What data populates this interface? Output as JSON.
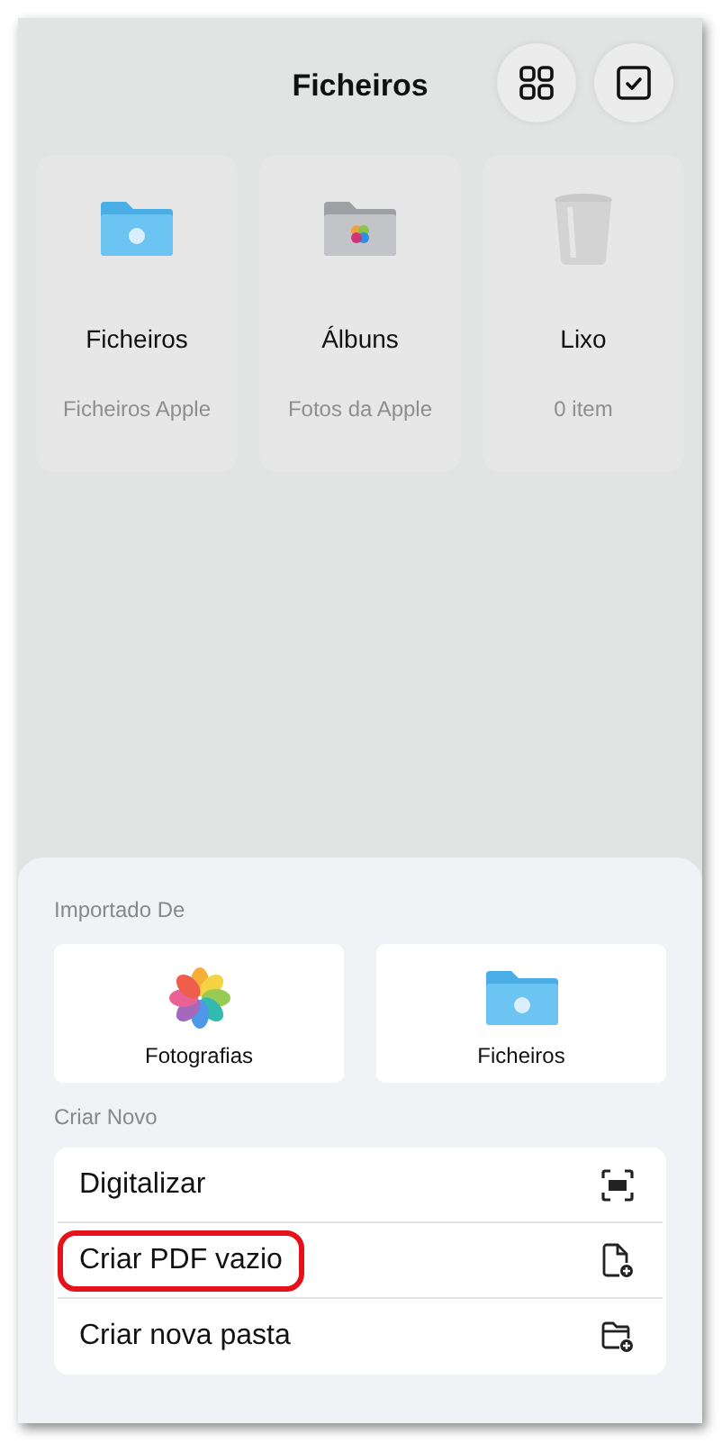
{
  "header": {
    "title": "Ficheiros"
  },
  "header_buttons": [
    {
      "kind": "grid"
    },
    {
      "kind": "select"
    }
  ],
  "locations": [
    {
      "kind": "apple-folder",
      "name": "Ficheiros",
      "subtitle": "Ficheiros Apple"
    },
    {
      "kind": "photos-folder",
      "name": "Álbuns",
      "subtitle": "Fotos da Apple"
    },
    {
      "kind": "trash",
      "name": "Lixo",
      "subtitle": "0 item"
    }
  ],
  "sheet": {
    "imported_title": "Importado De",
    "sources": [
      {
        "kind": "photos",
        "label": "Fotografias"
      },
      {
        "kind": "apple-folder",
        "label": "Ficheiros"
      }
    ],
    "create_title": "Criar Novo",
    "create_items": [
      {
        "kind": "scan",
        "label": "Digitalizar",
        "highlighted": false
      },
      {
        "kind": "pdf",
        "label": "Criar PDF vazio",
        "highlighted": true
      },
      {
        "kind": "folder",
        "label": "Criar nova pasta",
        "highlighted": false
      }
    ]
  }
}
